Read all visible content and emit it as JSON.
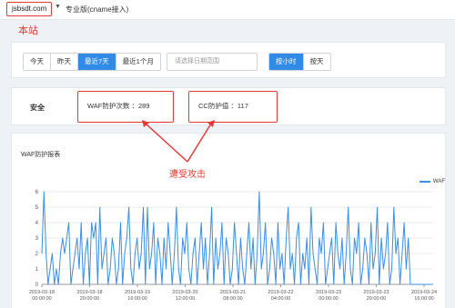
{
  "header": {
    "site": "jsbsdt.com",
    "plan": "专业版(cname接入)"
  },
  "annotations": {
    "site_note": "本站",
    "attack_note": "遭受攻击"
  },
  "filter": {
    "day_tabs": [
      "今天",
      "昨天",
      "最近7天",
      "最近1个月"
    ],
    "active_day_tab": "最近7天",
    "date_placeholder": "请选择日期范围",
    "gran_tabs": [
      "按小时",
      "按天"
    ],
    "active_gran_tab": "按小时"
  },
  "stats": {
    "label": "安全",
    "waf_text": "WAF防护次数 ：289",
    "cc_text": "CC防护值 ：117"
  },
  "chart": {
    "title": "WAF防护报表",
    "legend": "WAF",
    "color": "#3b8ee7"
  },
  "chart_data": {
    "type": "line",
    "title": "WAF防护报表",
    "ylim": [
      0,
      6
    ],
    "yticks": [
      0,
      1,
      2,
      3,
      4,
      5,
      6
    ],
    "xtick_labels": [
      [
        "2019-03-18",
        "00:00:00"
      ],
      [
        "2019-03-18",
        "20:00:00"
      ],
      [
        "2019-03-19",
        "16:00:00"
      ],
      [
        "2019-03-20",
        "12:00:00"
      ],
      [
        "2019-03-21",
        "08:00:00"
      ],
      [
        "2019-03-22",
        "04:00:00"
      ],
      [
        "2019-03-23",
        "00:00:00"
      ],
      [
        "2019-03-23",
        "20:00:00"
      ],
      [
        "2019-03-24",
        "16:00:00"
      ]
    ],
    "grid": true,
    "legend_position": "top-right",
    "series": [
      {
        "name": "WAF",
        "values": [
          2,
          6,
          2,
          0,
          1,
          2,
          0,
          1,
          0,
          2,
          3,
          2,
          3,
          4,
          0,
          1,
          2,
          3,
          1,
          4,
          0,
          2,
          3,
          0,
          4,
          3,
          4,
          0,
          5,
          1,
          2,
          3,
          0,
          1,
          3,
          2,
          0,
          1,
          4,
          0,
          2,
          3,
          5,
          1,
          0,
          2,
          3,
          1,
          2,
          5,
          0,
          5,
          1,
          2,
          4,
          0,
          3,
          2,
          0,
          3,
          1,
          4,
          2,
          0,
          2,
          5,
          1,
          0,
          3,
          2,
          4,
          1,
          0,
          2,
          3,
          0,
          2,
          4,
          1,
          3,
          0,
          2,
          5,
          0,
          3,
          1,
          2,
          4,
          0,
          3,
          2,
          0,
          1,
          4,
          2,
          0,
          3,
          1,
          0,
          2,
          4,
          1,
          3,
          0,
          2,
          6,
          1,
          2,
          4,
          0,
          1,
          3,
          2,
          0,
          4,
          1,
          2,
          0,
          3,
          5,
          1,
          2,
          0,
          3,
          4,
          0,
          2,
          1,
          3,
          0,
          5,
          2,
          1,
          0,
          3,
          2,
          4,
          0,
          1,
          2,
          3,
          0,
          4,
          2,
          1,
          3,
          0,
          2,
          5,
          1,
          0,
          3,
          2,
          4,
          0,
          1,
          3,
          2,
          0,
          4,
          1,
          2,
          5,
          0,
          3,
          1,
          2,
          4,
          0,
          1,
          5,
          2,
          3,
          0,
          2,
          4,
          1,
          3,
          0,
          0,
          0,
          0,
          0,
          0,
          0,
          0,
          0,
          0,
          0,
          0
        ]
      }
    ]
  }
}
